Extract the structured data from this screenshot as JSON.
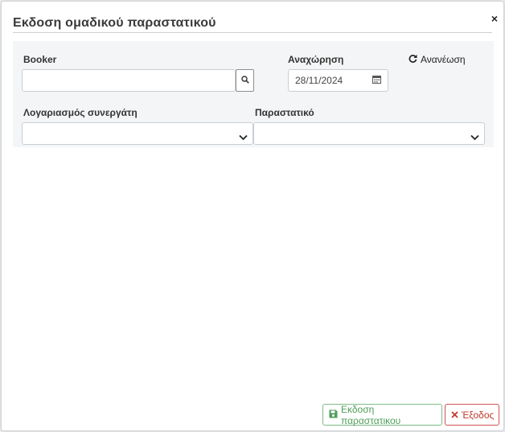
{
  "dialog": {
    "title": "Εκδοση ομαδικού παραστατικού",
    "close_glyph": "×"
  },
  "form": {
    "booker": {
      "label": "Booker",
      "value": "",
      "placeholder": ""
    },
    "departure": {
      "label": "Αναχώρηση",
      "value": "28/11/2024"
    },
    "refresh_label": "Ανανέωση",
    "partner_account": {
      "label": "Λογαριασμός συνεργάτη",
      "selected": ""
    },
    "document": {
      "label": "Παραστατικό",
      "selected": ""
    }
  },
  "footer": {
    "issue_label": "Εκδοση παραστατικου",
    "exit_label": "Έξοδος"
  },
  "colors": {
    "issue_green": "#4f9e59",
    "exit_red": "#c0392b"
  },
  "icons": [
    "close-icon",
    "search-icon",
    "calendar-icon",
    "refresh-icon",
    "chevron-down-icon",
    "save-icon",
    "times-icon"
  ]
}
